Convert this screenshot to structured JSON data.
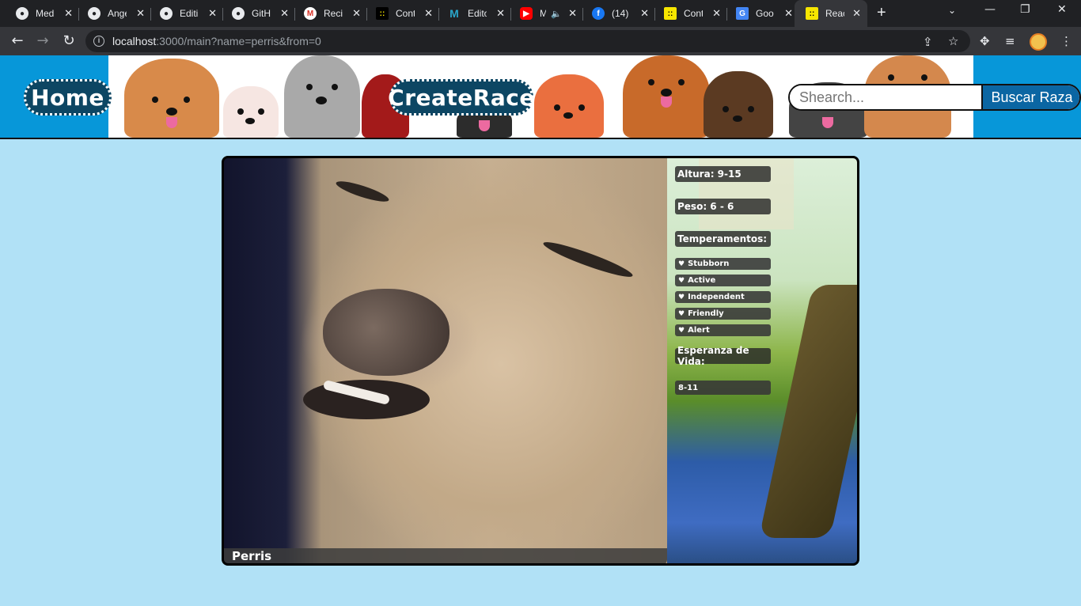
{
  "browser": {
    "tabs": [
      {
        "label": "Medi",
        "icon": "github-icon"
      },
      {
        "label": "Ange",
        "icon": "github-icon"
      },
      {
        "label": "Editin",
        "icon": "github-icon"
      },
      {
        "label": "GitHu",
        "icon": "github-icon"
      },
      {
        "label": "Recib",
        "icon": "gmail-icon"
      },
      {
        "label": "Cont",
        "icon": "bulletin-icon"
      },
      {
        "label": "Edito",
        "icon": "medium-icon"
      },
      {
        "label": "M",
        "icon": "youtube-icon"
      },
      {
        "label": "(14) ",
        "icon": "facebook-icon"
      },
      {
        "label": "Cont",
        "icon": "bulletin-icon"
      },
      {
        "label": "Goo",
        "icon": "google-translate-icon"
      },
      {
        "label": "Reac",
        "icon": "bulletin-icon"
      }
    ],
    "url_host": "localhost",
    "url_rest": ":3000/main?name=perris&from=0"
  },
  "header": {
    "home_label": "Home",
    "create_label": "CreateRace",
    "search_placeholder": "Shearch...",
    "search_button": "Buscar Raza"
  },
  "dog": {
    "name": "Perris",
    "height": "Altura: 9-15",
    "weight": "Peso: 6 - 6",
    "temperaments_title": "Temperamentos:",
    "temperaments": [
      "Stubborn",
      "Active",
      "Independent",
      "Friendly",
      "Alert"
    ],
    "life_title": "Esperanza de Vida:",
    "life_span": "8-11"
  },
  "colors": {
    "page_bg": "#b1e1f6",
    "header_bg": "#0797d9",
    "pill_bg": "#0d4663",
    "search_button_bg": "#0b66a3"
  }
}
